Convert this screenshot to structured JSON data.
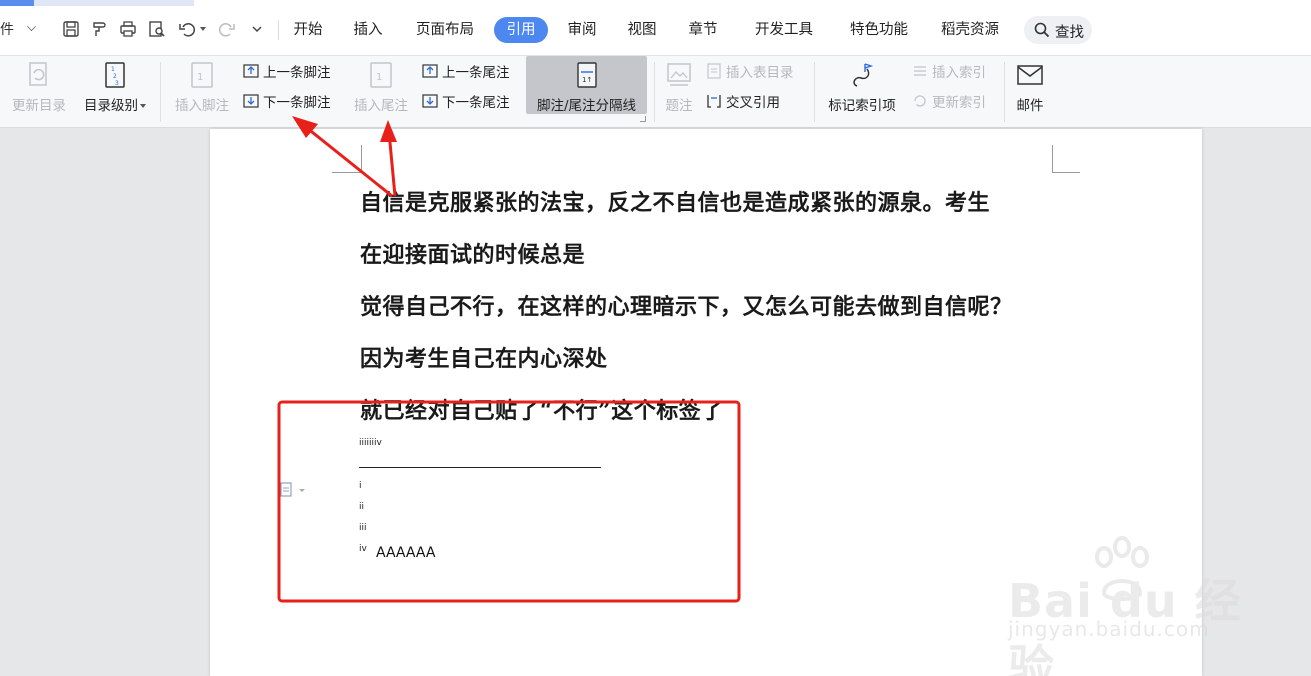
{
  "menubar": {
    "file_label": "件",
    "tabs": [
      {
        "label": "开始"
      },
      {
        "label": "插入"
      },
      {
        "label": "页面布局"
      },
      {
        "label": "引用"
      },
      {
        "label": "审阅"
      },
      {
        "label": "视图"
      },
      {
        "label": "章节"
      },
      {
        "label": "开发工具"
      },
      {
        "label": "特色功能"
      },
      {
        "label": "稻壳资源"
      }
    ],
    "active_tab": "引用",
    "search_label": "查找"
  },
  "ribbon": {
    "update_toc": "更新目录",
    "toc_level": "目录级别",
    "insert_footnote": "插入脚注",
    "prev_footnote": "上一条脚注",
    "next_footnote": "下一条脚注",
    "insert_endnote": "插入尾注",
    "prev_endnote": "上一条尾注",
    "next_endnote": "下一条尾注",
    "separator_line": "脚注/尾注分隔线",
    "caption": "题注",
    "insert_table_of_figures": "插入表目录",
    "cross_reference": "交叉引用",
    "mark_index_entry": "标记索引项",
    "insert_index": "插入索引",
    "update_index": "更新索引",
    "mail": "邮件"
  },
  "document": {
    "paragraphs": [
      "自信是克服紧张的法宝，反之不自信也是造成紧张的源泉。考生",
      "在迎接面试的时候总是",
      "觉得自己不行，在这样的心理暗示下，又怎么可能去做到自信呢？",
      "因为考生自己在内心深处",
      "就已经对自己贴了“不行”这个标签了"
    ],
    "reference_marks": "iiiiiiiv",
    "footnotes": [
      {
        "mark": "i",
        "text": ""
      },
      {
        "mark": "ii",
        "text": ""
      },
      {
        "mark": "iii",
        "text": ""
      },
      {
        "mark": "iv",
        "text": "AAAAAA"
      }
    ]
  },
  "watermark": {
    "brand": "Bai du 经验",
    "url": "jingyan.baidu.com"
  },
  "colors": {
    "accent": "#4d88f0",
    "annotation_red": "#e8201a",
    "disabled_text": "#b5b8bd"
  }
}
